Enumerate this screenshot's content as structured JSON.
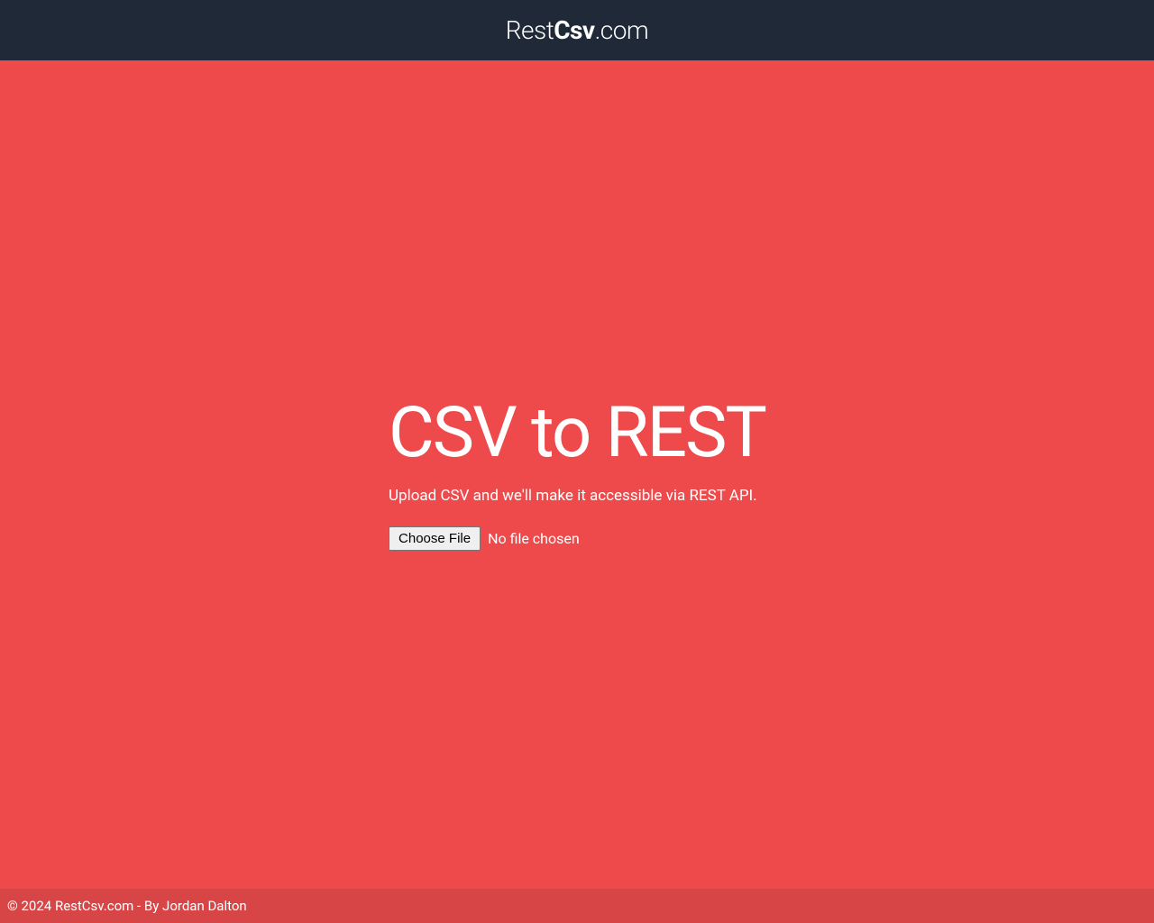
{
  "header": {
    "logo_part1": "Rest",
    "logo_part2": "Csv",
    "logo_part3": ".com"
  },
  "main": {
    "hero_title": "CSV to REST",
    "hero_subtitle": "Upload CSV and we'll make it accessible via REST API.",
    "choose_file_label": "Choose File",
    "file_status": "No file chosen"
  },
  "footer": {
    "copyright": "© 2024 RestCsv.com - By Jordan Dalton"
  }
}
